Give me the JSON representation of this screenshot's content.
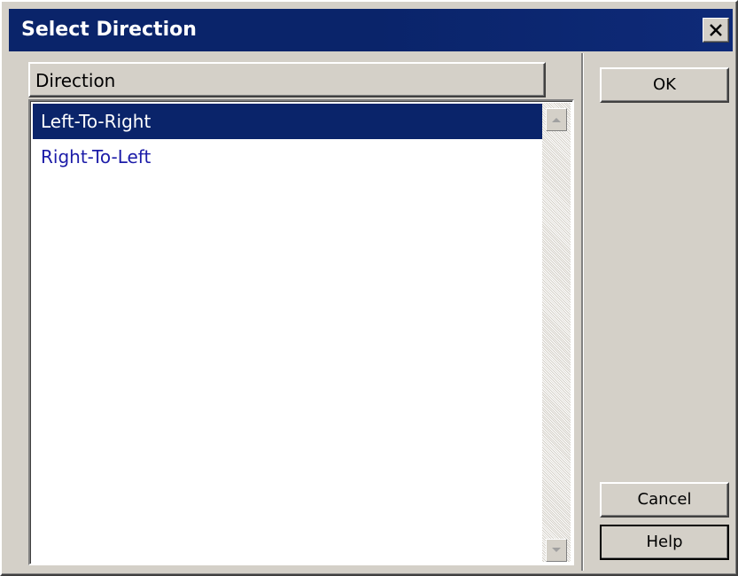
{
  "dialog": {
    "title": "Select Direction"
  },
  "list": {
    "column_header": "Direction",
    "items": [
      {
        "label": "Left-To-Right",
        "selected": true
      },
      {
        "label": "Right-To-Left",
        "selected": false
      }
    ]
  },
  "buttons": {
    "ok_label": "OK",
    "cancel_label": "Cancel",
    "help_label": "Help"
  },
  "colors": {
    "titlebar": "#0a246a",
    "selection": "#0a246a",
    "item_text": "#1c1ca8",
    "face": "#d4d0c8"
  },
  "icons": {
    "close": "close-icon",
    "scroll_up": "scroll-up-arrow-icon",
    "scroll_down": "scroll-down-arrow-icon"
  }
}
